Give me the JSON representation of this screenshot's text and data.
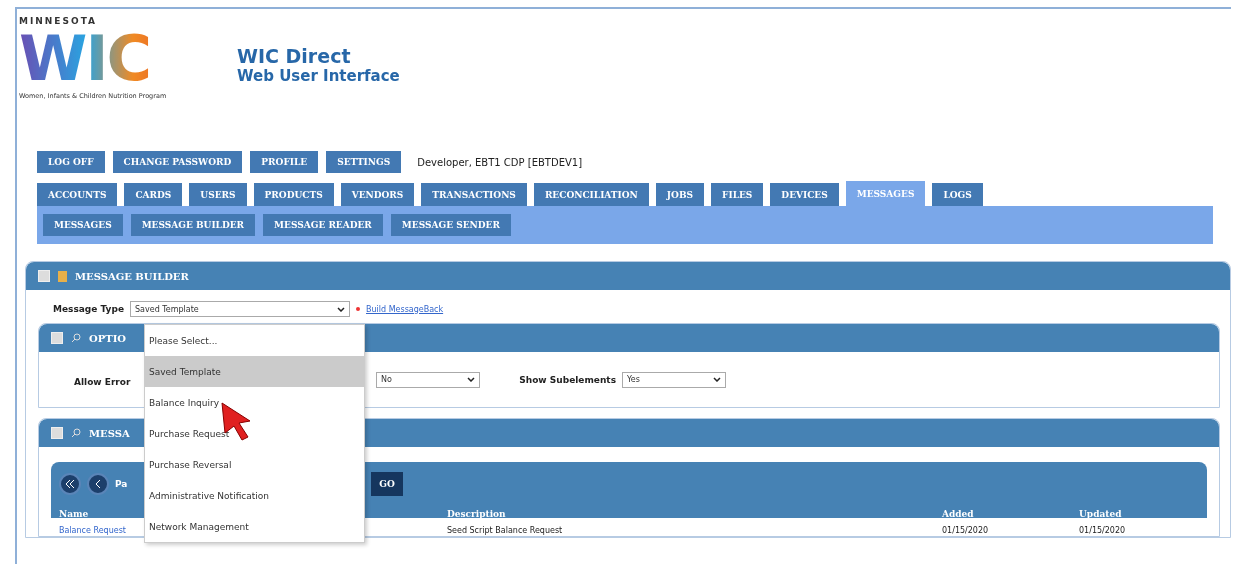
{
  "header": {
    "logo_state": "MINNESOTA",
    "logo_word": "WIC",
    "logo_tagline": "Women, Infants & Children Nutrition Program",
    "title": "WIC Direct",
    "subtitle": "Web User Interface"
  },
  "top_buttons": [
    "LOG OFF",
    "CHANGE PASSWORD",
    "PROFILE",
    "SETTINGS"
  ],
  "user": "Developer, EBT1 CDP [EBTDEV1]",
  "tabs": [
    {
      "label": "ACCOUNTS",
      "selected": false
    },
    {
      "label": "CARDS",
      "selected": false
    },
    {
      "label": "USERS",
      "selected": false
    },
    {
      "label": "PRODUCTS",
      "selected": false
    },
    {
      "label": "VENDORS",
      "selected": false
    },
    {
      "label": "TRANSACTIONS",
      "selected": false
    },
    {
      "label": "RECONCILIATION",
      "selected": false
    },
    {
      "label": "JOBS",
      "selected": false
    },
    {
      "label": "FILES",
      "selected": false
    },
    {
      "label": "DEVICES",
      "selected": false
    },
    {
      "label": "MESSAGES",
      "selected": true
    },
    {
      "label": "LOGS",
      "selected": false
    }
  ],
  "subtabs": [
    "MESSAGES",
    "MESSAGE BUILDER",
    "MESSAGE READER",
    "MESSAGE SENDER"
  ],
  "builder": {
    "title": "MESSAGE BUILDER",
    "message_type_label": "Message Type",
    "message_type_value": "Saved Template",
    "link": "Build MessageBack",
    "dropdown": [
      {
        "label": "Please Select...",
        "selected": false
      },
      {
        "label": "Saved Template",
        "selected": true
      },
      {
        "label": "Balance Inquiry",
        "selected": false
      },
      {
        "label": "Purchase Request",
        "selected": false
      },
      {
        "label": "Purchase Reversal",
        "selected": false
      },
      {
        "label": "Administrative Notification",
        "selected": false
      },
      {
        "label": "Network Management",
        "selected": false
      }
    ]
  },
  "options": {
    "title": "OPTIO",
    "allow_label": "Allow Error",
    "field_2_value": "No",
    "show_label": "Show Subelements",
    "show_value": "Yes"
  },
  "messages": {
    "title": "MESSA",
    "pager_label": "Pa",
    "go": "GO",
    "columns": [
      "Name",
      "Description",
      "Added",
      "Updated"
    ],
    "rows": [
      [
        "Balance Request",
        "Seed Script Balance Request",
        "01/15/2020",
        "01/15/2020"
      ]
    ]
  }
}
